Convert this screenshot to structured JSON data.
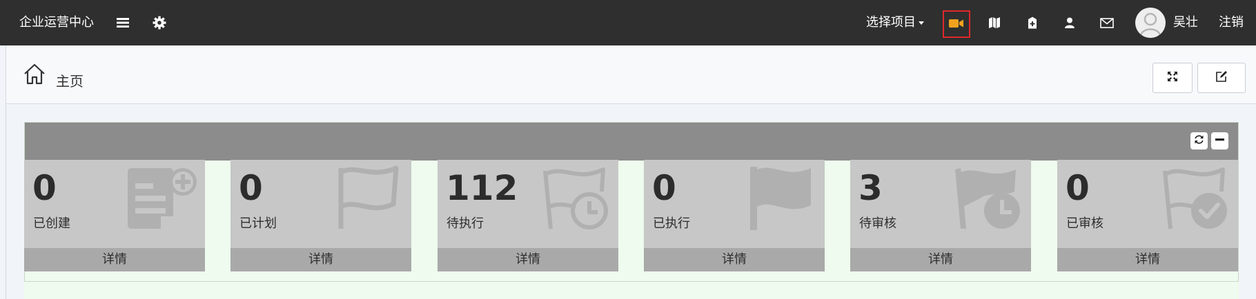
{
  "header": {
    "brand": "企业运营中心",
    "project_select": "选择项目",
    "username": "吴壮",
    "logout": "注销",
    "icons": [
      "menu-icon",
      "gear-icon",
      "video-camera-icon",
      "map-icon",
      "clipboard-icon",
      "user-icon",
      "mail-icon"
    ],
    "video_icon_color": "#f0a21f",
    "video_highlight_border": "#e0282c"
  },
  "breadcrumb": {
    "label": "主页"
  },
  "panel": {
    "header_color": "#8c8c8c",
    "body_color": "#eefbee"
  },
  "stats": [
    {
      "value": "0",
      "label": "已创建",
      "link": "详情",
      "icon": "list-plus-icon"
    },
    {
      "value": "0",
      "label": "已计划",
      "link": "详情",
      "icon": "flag-outline-icon"
    },
    {
      "value": "112",
      "label": "待执行",
      "link": "详情",
      "icon": "flag-clock-outline-icon"
    },
    {
      "value": "0",
      "label": "已执行",
      "link": "详情",
      "icon": "flag-filled-icon"
    },
    {
      "value": "3",
      "label": "待审核",
      "link": "详情",
      "icon": "flag-clock-filled-icon"
    },
    {
      "value": "0",
      "label": "已审核",
      "link": "详情",
      "icon": "flag-check-icon"
    }
  ]
}
